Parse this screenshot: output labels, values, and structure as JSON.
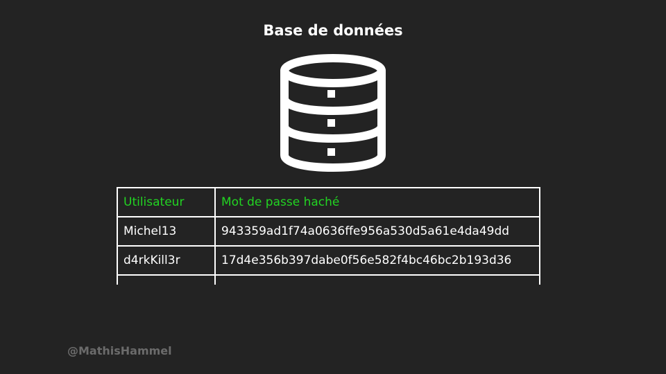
{
  "title": "Base de données",
  "icon": "database-icon",
  "table": {
    "headers": [
      "Utilisateur",
      "Mot de passe haché"
    ],
    "rows": [
      [
        "Michel13",
        "943359ad1f74a0636ffe956a530d5a61e4da49dd"
      ],
      [
        "d4rkKill3r",
        "17d4e356b397dabe0f56e582f4bc46bc2b193d36"
      ]
    ],
    "header_color": "#22d422"
  },
  "watermark": "@MathisHammel",
  "colors": {
    "background": "#232323",
    "foreground": "#ffffff",
    "watermark": "#6b6b6b"
  }
}
